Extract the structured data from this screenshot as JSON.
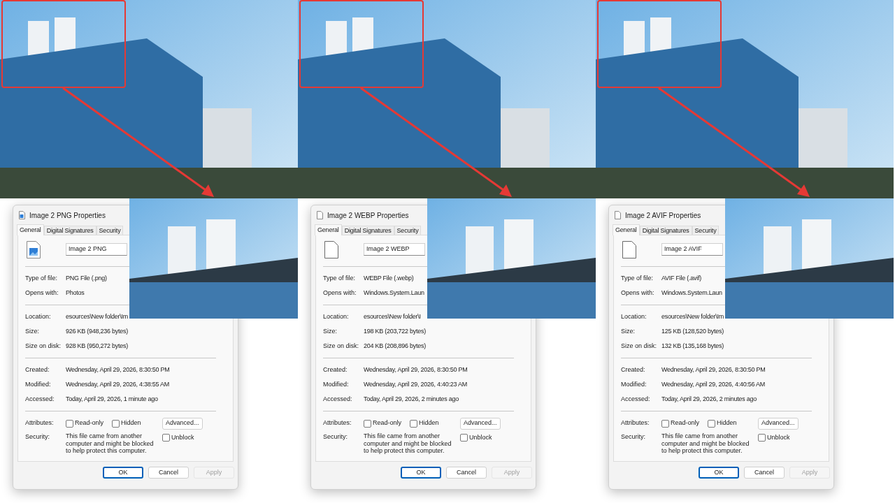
{
  "panels": [
    {
      "dialog": {
        "title": "Image 2 PNG Properties",
        "file_icon": {
          "kind": "image"
        },
        "tabs": [
          {
            "label": "General",
            "selected": true
          },
          {
            "label": "Digital Signatures",
            "selected": false
          },
          {
            "label": "Security",
            "selected": false
          }
        ],
        "file_name": "Image 2 PNG",
        "type_rows": [
          {
            "label": "Type of file:",
            "value": "PNG File (.png)"
          },
          {
            "label": "Opens with:",
            "value": "Photos"
          }
        ],
        "location_rows": [
          {
            "label": "Location:",
            "value": "esources\\New folder\\Im"
          },
          {
            "label": "Size:",
            "value": "926 KB (948,236 bytes)"
          },
          {
            "label": "Size on disk:",
            "value": "928 KB (950,272 bytes)"
          }
        ],
        "date_rows": [
          {
            "label": "Created:",
            "value": "Wednesday, April 29, 2026, 8:30:50 PM"
          },
          {
            "label": "Modified:",
            "value": "Wednesday, April 29, 2026, 4:38:55 AM"
          },
          {
            "label": "Accessed:",
            "value": "Today, April 29, 2026, 1 minute ago"
          }
        ],
        "attributes_label": "Attributes:",
        "checkboxes": [
          {
            "label": "Read-only",
            "checked": false
          },
          {
            "label": "Hidden",
            "checked": false
          }
        ],
        "advanced_button": "Advanced...",
        "security_label": "Security:",
        "security_text": "This file came from another computer and might be blocked to help protect this computer.",
        "unblock": {
          "label": "Unblock",
          "checked": false
        },
        "buttons": [
          {
            "label": "OK",
            "default": true,
            "disabled": false
          },
          {
            "label": "Cancel",
            "default": false,
            "disabled": false
          },
          {
            "label": "Apply",
            "default": false,
            "disabled": true
          }
        ]
      }
    },
    {
      "dialog": {
        "title": "Image 2 WEBP Properties",
        "file_icon": {
          "kind": "blank"
        },
        "tabs": [
          {
            "label": "General",
            "selected": true
          },
          {
            "label": "Digital Signatures",
            "selected": false
          },
          {
            "label": "Security",
            "selected": false
          }
        ],
        "file_name": "Image 2 WEBP",
        "type_rows": [
          {
            "label": "Type of file:",
            "value": "WEBP File (.webp)"
          },
          {
            "label": "Opens with:",
            "value": "Windows.System.Laun"
          }
        ],
        "location_rows": [
          {
            "label": "Location:",
            "value": "esources\\New folder\\I"
          },
          {
            "label": "Size:",
            "value": "198 KB (203,722 bytes)"
          },
          {
            "label": "Size on disk:",
            "value": "204 KB (208,896 bytes)"
          }
        ],
        "date_rows": [
          {
            "label": "Created:",
            "value": "Wednesday, April 29, 2026, 8:30:50 PM"
          },
          {
            "label": "Modified:",
            "value": "Wednesday, April 29, 2026, 4:40:23 AM"
          },
          {
            "label": "Accessed:",
            "value": "Today, April 29, 2026, 2 minutes ago"
          }
        ],
        "attributes_label": "Attributes:",
        "checkboxes": [
          {
            "label": "Read-only",
            "checked": false
          },
          {
            "label": "Hidden",
            "checked": false
          }
        ],
        "advanced_button": "Advanced...",
        "security_label": "Security:",
        "security_text": "This file came from another computer and might be blocked to help protect this computer.",
        "unblock": {
          "label": "Unblock",
          "checked": false
        },
        "buttons": [
          {
            "label": "OK",
            "default": true,
            "disabled": false
          },
          {
            "label": "Cancel",
            "default": false,
            "disabled": false
          },
          {
            "label": "Apply",
            "default": false,
            "disabled": true
          }
        ]
      }
    },
    {
      "dialog": {
        "title": "Image 2 AVIF Properties",
        "file_icon": {
          "kind": "blank"
        },
        "tabs": [
          {
            "label": "General",
            "selected": true
          },
          {
            "label": "Digital Signatures",
            "selected": false
          },
          {
            "label": "Security",
            "selected": false
          }
        ],
        "file_name": "Image 2 AVIF",
        "type_rows": [
          {
            "label": "Type of file:",
            "value": "AVIF File (.avif)"
          },
          {
            "label": "Opens with:",
            "value": "Windows.System.Laun"
          }
        ],
        "location_rows": [
          {
            "label": "Location:",
            "value": "esources\\New folder\\Im"
          },
          {
            "label": "Size:",
            "value": "125 KB (128,520 bytes)"
          },
          {
            "label": "Size on disk:",
            "value": "132 KB (135,168 bytes)"
          }
        ],
        "date_rows": [
          {
            "label": "Created:",
            "value": "Wednesday, April 29, 2026, 8:30:50 PM"
          },
          {
            "label": "Modified:",
            "value": "Wednesday, April 29, 2026, 4:40:56 AM"
          },
          {
            "label": "Accessed:",
            "value": "Today, April 29, 2026, 2 minutes ago"
          }
        ],
        "attributes_label": "Attributes:",
        "checkboxes": [
          {
            "label": "Read-only",
            "checked": false
          },
          {
            "label": "Hidden",
            "checked": false
          }
        ],
        "advanced_button": "Advanced...",
        "security_label": "Security:",
        "security_text": "This file came from another computer and might be blocked to help protect this computer.",
        "unblock": {
          "label": "Unblock",
          "checked": false
        },
        "buttons": [
          {
            "label": "OK",
            "default": true,
            "disabled": false
          },
          {
            "label": "Cancel",
            "default": false,
            "disabled": false
          },
          {
            "label": "Apply",
            "default": false,
            "disabled": true
          }
        ]
      }
    }
  ]
}
